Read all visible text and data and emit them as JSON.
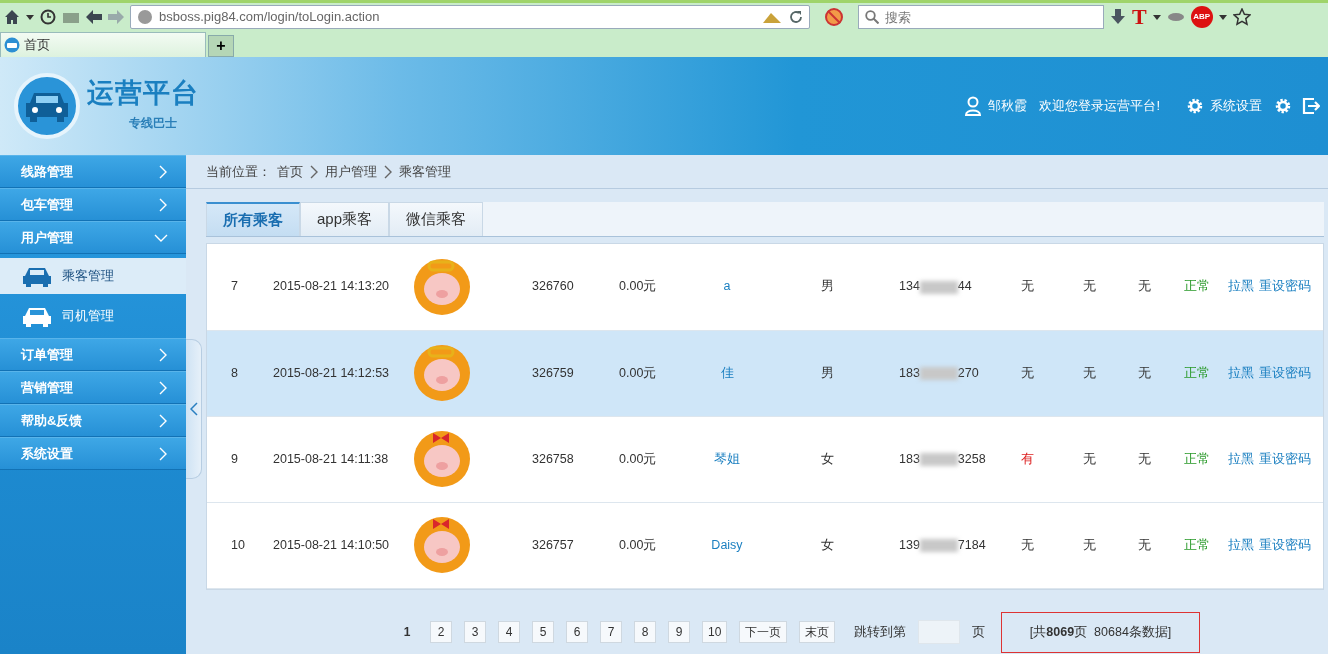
{
  "browser": {
    "url": "bsboss.pig84.com/login/toLogin.action",
    "search": {
      "placeholder": "搜索"
    },
    "extension_labels": [
      "T",
      "ABP"
    ],
    "tabs": [
      {
        "label": "首页",
        "selected": true
      }
    ],
    "new_tab": "+"
  },
  "header": {
    "logo_title": "运营平台",
    "logo_subtitle": "专线巴士",
    "user_name": "邹秋霞",
    "welcome": "欢迎您登录运营平台!",
    "settings": "系统设置"
  },
  "sidebar": {
    "items": [
      {
        "label": "线路管理",
        "expanded": false
      },
      {
        "label": "包车管理",
        "expanded": false
      },
      {
        "label": "用户管理",
        "expanded": true,
        "children": [
          {
            "label": "乘客管理",
            "selected": true
          },
          {
            "label": "司机管理",
            "selected": false
          }
        ]
      },
      {
        "label": "订单管理",
        "expanded": false
      },
      {
        "label": "营销管理",
        "expanded": false
      },
      {
        "label": "帮助&反馈",
        "expanded": false
      },
      {
        "label": "系统设置",
        "expanded": false
      }
    ]
  },
  "breadcrumb": {
    "prefix": "当前位置：",
    "items": [
      "首页",
      "用户管理",
      "乘客管理"
    ]
  },
  "tabs": [
    {
      "label": "所有乘客",
      "selected": true
    },
    {
      "label": "app乘客",
      "selected": false
    },
    {
      "label": "微信乘客",
      "selected": false
    }
  ],
  "table": {
    "rows": [
      {
        "selected": false,
        "cells": [
          {
            "kind": "text",
            "text": "7"
          },
          {
            "kind": "text",
            "text": "2015-08-21 14:13:20"
          },
          {
            "kind": "avatar",
            "bow": false
          },
          {
            "kind": "text",
            "text": "326760"
          },
          {
            "kind": "text",
            "text": "0.00元"
          },
          {
            "kind": "link",
            "text": "a"
          },
          {
            "kind": "text",
            "text": "男"
          },
          {
            "kind": "phone",
            "prefix": "134",
            "suffix": "44"
          },
          {
            "kind": "flag",
            "text": "无",
            "alert": false
          },
          {
            "kind": "flag",
            "text": "无",
            "alert": false
          },
          {
            "kind": "flag",
            "text": "无",
            "alert": false
          },
          {
            "kind": "status",
            "text": "正常"
          },
          {
            "kind": "actions",
            "links": [
              "拉黑",
              "重设密码"
            ]
          }
        ]
      },
      {
        "selected": true,
        "cells": [
          {
            "kind": "text",
            "text": "8"
          },
          {
            "kind": "text",
            "text": "2015-08-21 14:12:53"
          },
          {
            "kind": "avatar",
            "bow": false
          },
          {
            "kind": "text",
            "text": "326759"
          },
          {
            "kind": "text",
            "text": "0.00元"
          },
          {
            "kind": "link",
            "text": "佳"
          },
          {
            "kind": "text",
            "text": "男"
          },
          {
            "kind": "phone",
            "prefix": "183",
            "suffix": "270"
          },
          {
            "kind": "flag",
            "text": "无",
            "alert": false
          },
          {
            "kind": "flag",
            "text": "无",
            "alert": false
          },
          {
            "kind": "flag",
            "text": "无",
            "alert": false
          },
          {
            "kind": "status",
            "text": "正常"
          },
          {
            "kind": "actions",
            "links": [
              "拉黑",
              "重设密码"
            ]
          }
        ]
      },
      {
        "selected": false,
        "cells": [
          {
            "kind": "text",
            "text": "9"
          },
          {
            "kind": "text",
            "text": "2015-08-21 14:11:38"
          },
          {
            "kind": "avatar",
            "bow": true
          },
          {
            "kind": "text",
            "text": "326758"
          },
          {
            "kind": "text",
            "text": "0.00元"
          },
          {
            "kind": "link",
            "text": "琴姐"
          },
          {
            "kind": "text",
            "text": "女"
          },
          {
            "kind": "phone",
            "prefix": "183",
            "suffix": "3258"
          },
          {
            "kind": "flag",
            "text": "有",
            "alert": true
          },
          {
            "kind": "flag",
            "text": "无",
            "alert": false
          },
          {
            "kind": "flag",
            "text": "无",
            "alert": false
          },
          {
            "kind": "status",
            "text": "正常"
          },
          {
            "kind": "actions",
            "links": [
              "拉黑",
              "重设密码"
            ]
          }
        ]
      },
      {
        "selected": false,
        "cells": [
          {
            "kind": "text",
            "text": "10"
          },
          {
            "kind": "text",
            "text": "2015-08-21 14:10:50"
          },
          {
            "kind": "avatar",
            "bow": true
          },
          {
            "kind": "text",
            "text": "326757"
          },
          {
            "kind": "text",
            "text": "0.00元"
          },
          {
            "kind": "link",
            "text": "Daisy"
          },
          {
            "kind": "text",
            "text": "女"
          },
          {
            "kind": "phone",
            "prefix": "139",
            "suffix": "7184"
          },
          {
            "kind": "flag",
            "text": "无",
            "alert": false
          },
          {
            "kind": "flag",
            "text": "无",
            "alert": false
          },
          {
            "kind": "flag",
            "text": "无",
            "alert": false
          },
          {
            "kind": "status",
            "text": "正常"
          },
          {
            "kind": "actions",
            "links": [
              "拉黑",
              "重设密码"
            ]
          }
        ]
      }
    ]
  },
  "pagination": {
    "pages": [
      {
        "label": "1",
        "selected": true
      },
      {
        "label": "2",
        "selected": false
      },
      {
        "label": "3",
        "selected": false
      },
      {
        "label": "4",
        "selected": false
      },
      {
        "label": "5",
        "selected": false
      },
      {
        "label": "6",
        "selected": false
      },
      {
        "label": "7",
        "selected": false
      },
      {
        "label": "8",
        "selected": false
      },
      {
        "label": "9",
        "selected": false
      },
      {
        "label": "10",
        "selected": false
      }
    ],
    "next": "下一页",
    "last": "末页",
    "jump_label": "跳转到第",
    "jump_unit": "页",
    "summary": {
      "text": "[共**8069**页  80684条数据]",
      "highlighted": true
    }
  }
}
